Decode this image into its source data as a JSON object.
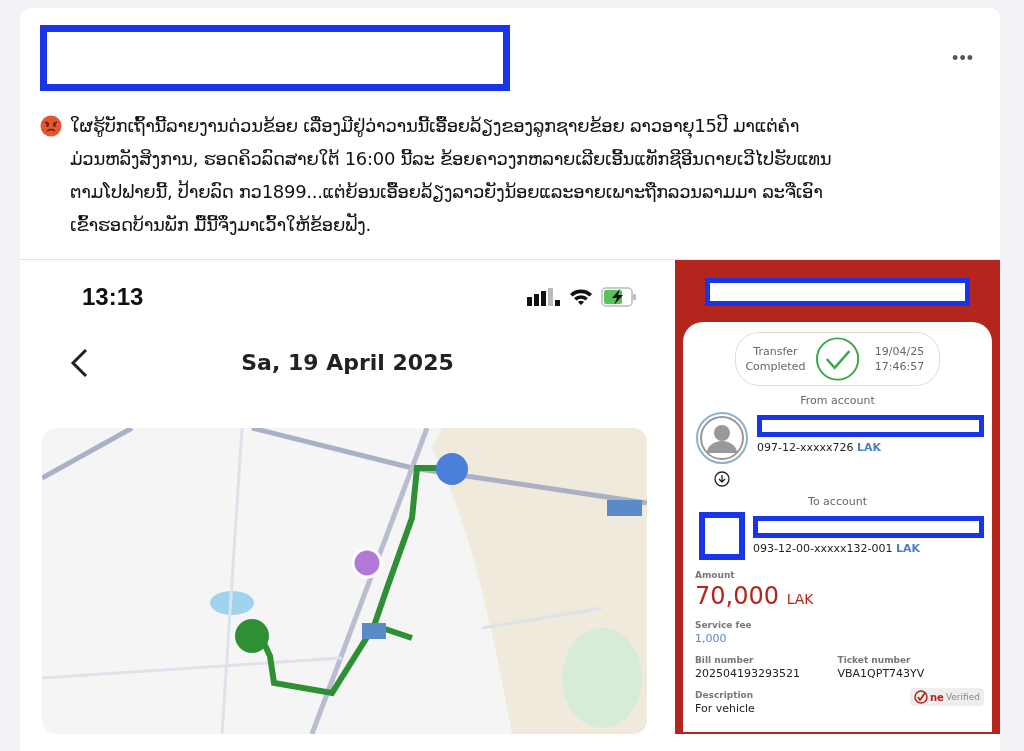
{
  "post": {
    "menu": "•••",
    "text": "ໃຜຮູ້ບັກເຖົ້ານີ້ລາຍງານດ່ວນຂ້ອຍ ເລື່ອງມີຢູ່ວ່າວານນີ້ເອື້ອຍລ້ຽງຂອງລູກຊາຍຂ້ອຍ ລາວອາຍຸ15ປີ ມາແຕ່ຄໍາ\nມ່ວນຫລັງສິງການ, ຮອດຄິວລົດສາຍໃຕ້ 16:00 ນີ້ລະ ຂ້ອຍຄາວງກຫລາຍເລີຍເອີ້ນແທັກຊີອີນດາຍເວີໄປຮັບແທນ\nຕາມໂປຟາຍນີ້, ປ້າຍລົດ ກວ1899...ແຕ່ຍ້ອນເອື້ອຍລ້ຽງລາວຍັງນ້ອຍແລະອາຍເພາະຖືກລວນລາມມາ ລະຈີ່ເອົາ\nເຂົ້າຮອດບ້ານພັກ ມື້ນີ້ຈຶ່ງມາເວົ້າໃຫ້ຂ້ອຍຟັງ."
  },
  "phone": {
    "time": "13:13",
    "title": "Sa, 19 April 2025"
  },
  "receipt": {
    "status": "Transfer Completed",
    "datetime": "19/04/25 17:46:57",
    "from_label": "From account",
    "from_account": "097-12-xxxxx726",
    "from_currency": "LAK",
    "to_label": "To account",
    "to_account": "093-12-00-xxxxx132-001",
    "to_currency": "LAK",
    "amount_label": "Amount",
    "amount": "70,000",
    "amount_currency": "LAK",
    "fee_label": "Service fee",
    "fee": "1,000",
    "bill_label": "Bill number",
    "bill": "202504193293521",
    "ticket_label": "Ticket number",
    "ticket": "VBA1QPT743YV",
    "description_label": "Description",
    "description": "For vehicle",
    "logo": "ne",
    "verified": "Verified"
  }
}
